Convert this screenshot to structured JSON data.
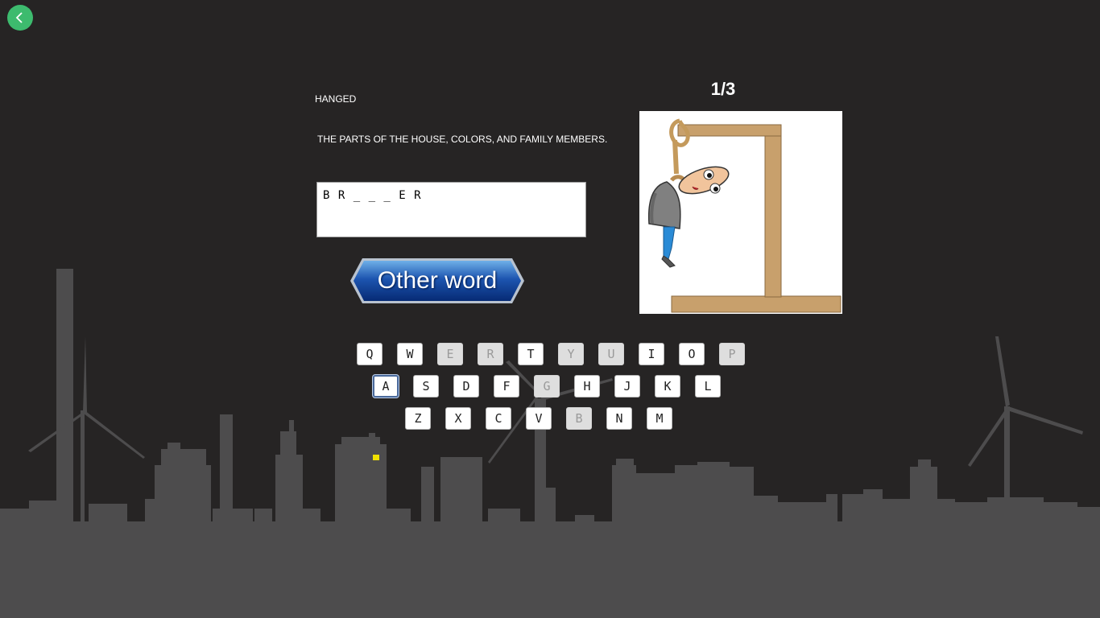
{
  "game": {
    "title": "HANGED",
    "hint": "THE PARTS OF THE HOUSE, COLORS, AND FAMILY MEMBERS.",
    "word_display": "B R _ _ _ E R",
    "other_word_label": "Other word",
    "counter": "1/3"
  },
  "nav": {
    "back_icon": "chevron-left-icon"
  },
  "keyboard": {
    "rows": [
      [
        {
          "letter": "Q",
          "used": false
        },
        {
          "letter": "W",
          "used": false
        },
        {
          "letter": "E",
          "used": true
        },
        {
          "letter": "R",
          "used": true
        },
        {
          "letter": "T",
          "used": false
        },
        {
          "letter": "Y",
          "used": true
        },
        {
          "letter": "U",
          "used": true
        },
        {
          "letter": "I",
          "used": false
        },
        {
          "letter": "O",
          "used": false
        },
        {
          "letter": "P",
          "used": true
        }
      ],
      [
        {
          "letter": "A",
          "used": false,
          "selected": true
        },
        {
          "letter": "S",
          "used": false
        },
        {
          "letter": "D",
          "used": false
        },
        {
          "letter": "F",
          "used": false
        },
        {
          "letter": "G",
          "used": true
        },
        {
          "letter": "H",
          "used": false
        },
        {
          "letter": "J",
          "used": false
        },
        {
          "letter": "K",
          "used": false
        },
        {
          "letter": "L",
          "used": false
        }
      ],
      [
        {
          "letter": "Z",
          "used": false
        },
        {
          "letter": "X",
          "used": false
        },
        {
          "letter": "C",
          "used": false
        },
        {
          "letter": "V",
          "used": false
        },
        {
          "letter": "B",
          "used": true
        },
        {
          "letter": "N",
          "used": false
        },
        {
          "letter": "M",
          "used": false
        }
      ]
    ]
  },
  "colors": {
    "background": "#262424",
    "skyline": "#4d4c4d",
    "accent_green": "#3dbb6e",
    "button_blue": "#0d3a8c"
  }
}
